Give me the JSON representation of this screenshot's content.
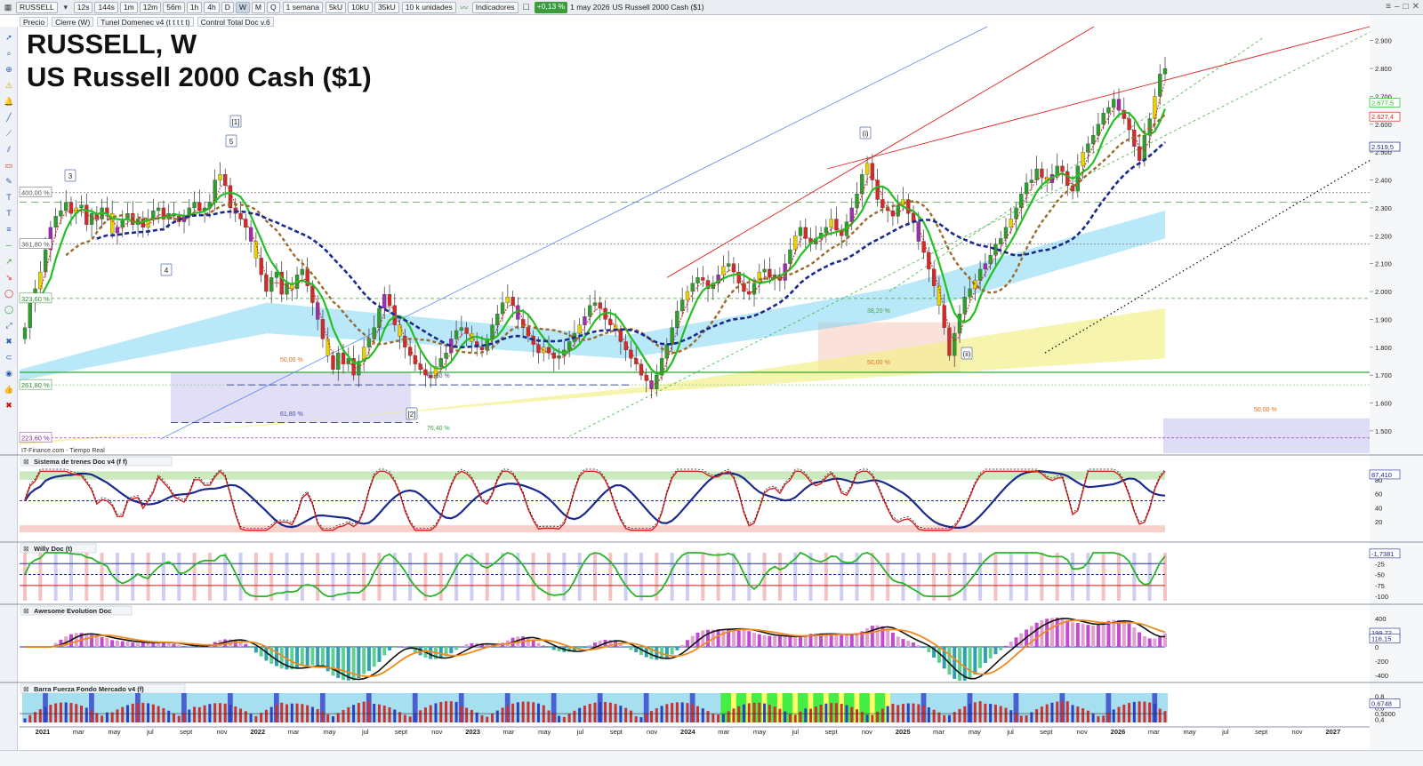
{
  "toolbar": {
    "symbol": "RUSSELL",
    "timeframes": [
      "12s",
      "144s",
      "1m",
      "12m",
      "56m",
      "1h",
      "4h",
      "D",
      "W",
      "M",
      "Q"
    ],
    "active_timeframe": "W",
    "period": "1 semana",
    "units_buttons": [
      "5kU",
      "10kU",
      "35kU"
    ],
    "units": "10 k unidades",
    "indicators": "Indicadores",
    "change_pct": "+0,13 %",
    "date": "1 may 2026",
    "instrument": "US Russell 2000 Cash ($1)"
  },
  "subbar": {
    "items": [
      "Precio",
      "Cierre (W)",
      "Tunel Domenec v4 (t t t t t)",
      "Control Total Doc v.6"
    ]
  },
  "title": {
    "line1": "RUSSELL, W",
    "line2": "US Russell 2000 Cash ($1)"
  },
  "source_label": "IT-Finance.com - Tiempo Real",
  "colors": {
    "up": "#2e9e2e",
    "down": "#d42a2a",
    "yellow_bar": "#e6d300",
    "purple_bar": "#9c2fb0",
    "green_line": "#22c022",
    "red_line": "#d92020",
    "blue_dots": "#1b2a8c",
    "brown_dots": "#9b6a2c",
    "cyan_band": "#7fd6f2",
    "yellow_band": "#f3f08a"
  },
  "chart_data": [
    {
      "type": "candlestick",
      "pane": "price",
      "title": "RUSSELL, W",
      "subtitle": "US Russell 2000 Cash ($1)",
      "y_ticks": [
        "2.900",
        "2.800",
        "2.700",
        "2.600",
        "2.500",
        "2.400",
        "2.300",
        "2.200",
        "2.100",
        "2.000",
        "1.900",
        "1.800",
        "1.700",
        "1.600",
        "1.500"
      ],
      "ylim": [
        1420,
        2950
      ],
      "price_labels": [
        {
          "text": "2.677,5",
          "value": 2677.5,
          "color": "#22c022"
        },
        {
          "text": "2.627,4",
          "value": 2627.4,
          "color": "#d92020"
        },
        {
          "text": "2.519,5",
          "value": 2519.5,
          "color": "#1b2a8c"
        }
      ],
      "x_ticks": [
        "2021",
        "mar",
        "may",
        "jul",
        "sept",
        "nov",
        "2022",
        "mar",
        "may",
        "jul",
        "sept",
        "nov",
        "2023",
        "mar",
        "may",
        "jul",
        "sept",
        "nov",
        "2024",
        "mar",
        "may",
        "jul",
        "sept",
        "nov",
        "2025",
        "mar",
        "may",
        "jul",
        "sept",
        "nov",
        "2026",
        "mar",
        "may",
        "jul",
        "sept",
        "nov",
        "2027",
        "mar"
      ],
      "closes": [
        1870,
        1960,
        2010,
        2070,
        2150,
        2230,
        2270,
        2290,
        2320,
        2280,
        2300,
        2310,
        2240,
        2280,
        2260,
        2300,
        2280,
        2210,
        2230,
        2260,
        2280,
        2240,
        2260,
        2230,
        2260,
        2290,
        2300,
        2260,
        2280,
        2270,
        2250,
        2270,
        2300,
        2320,
        2290,
        2300,
        2320,
        2400,
        2420,
        2380,
        2300,
        2280,
        2260,
        2230,
        2180,
        2120,
        2060,
        2000,
        2050,
        2070,
        1990,
        2030,
        2010,
        2060,
        2080,
        2020,
        1960,
        1900,
        1830,
        1770,
        1720,
        1780,
        1740,
        1760,
        1700,
        1750,
        1800,
        1830,
        1870,
        1940,
        1990,
        1950,
        1880,
        1840,
        1800,
        1770,
        1740,
        1720,
        1700,
        1690,
        1730,
        1760,
        1780,
        1830,
        1860,
        1870,
        1850,
        1820,
        1800,
        1790,
        1830,
        1880,
        1920,
        1960,
        1980,
        1950,
        1900,
        1870,
        1840,
        1810,
        1780,
        1800,
        1780,
        1760,
        1770,
        1790,
        1820,
        1850,
        1880,
        1910,
        1950,
        1960,
        1940,
        1900,
        1880,
        1860,
        1820,
        1790,
        1760,
        1740,
        1700,
        1680,
        1650,
        1700,
        1760,
        1810,
        1870,
        1930,
        1970,
        2000,
        2030,
        2050,
        2040,
        2010,
        2030,
        2060,
        2090,
        2100,
        2070,
        2030,
        2000,
        1990,
        2030,
        2070,
        2080,
        2050,
        2060,
        2040,
        2100,
        2150,
        2200,
        2230,
        2190,
        2170,
        2190,
        2210,
        2230,
        2260,
        2220,
        2200,
        2250,
        2300,
        2350,
        2420,
        2460,
        2400,
        2330,
        2300,
        2290,
        2270,
        2310,
        2330,
        2280,
        2250,
        2180,
        2140,
        2080,
        2020,
        1950,
        1870,
        1770,
        1850,
        1920,
        1980,
        2010,
        2040,
        2080,
        2100,
        2130,
        2170,
        2190,
        2230,
        2260,
        2300,
        2350,
        2390,
        2400,
        2440,
        2410,
        2390,
        2420,
        2450,
        2430,
        2380,
        2360,
        2450,
        2500,
        2530,
        2560,
        2600,
        2640,
        2660,
        2690,
        2650,
        2620,
        2580,
        2520,
        2470,
        2560,
        2620,
        2700,
        2780,
        2800
      ]
    },
    {
      "type": "line",
      "pane": "oscillator",
      "title": "Sistema de trenes Doc v4 (f f)",
      "y_ticks": [
        "80",
        "60",
        "40",
        "20"
      ],
      "labels": [
        {
          "text": "87,410",
          "value": 87.41
        }
      ],
      "ylim": [
        0,
        100
      ]
    },
    {
      "type": "line",
      "pane": "oscillator",
      "title": "Willy Doc (t)",
      "y_ticks": [
        "-25",
        "-50",
        "-75",
        "-100"
      ],
      "labels": [
        {
          "text": "-1,7381",
          "value": -1.7381
        }
      ],
      "ylim": [
        -110,
        0
      ]
    },
    {
      "type": "bar",
      "pane": "oscillator",
      "title": "Awesome Evolution Doc",
      "y_ticks": [
        "400",
        "200",
        "0",
        "-200",
        "-400"
      ],
      "labels": [
        {
          "text": "199,72",
          "value": 199.72
        },
        {
          "text": "116,15",
          "value": 116.15
        }
      ],
      "ylim": [
        -450,
        450
      ]
    },
    {
      "type": "bar",
      "pane": "oscillator",
      "title": "Barra Fuerza Fondo Mercado v4 (f)",
      "y_ticks": [
        "0,8",
        "0,6",
        "0,5000",
        "0,4"
      ],
      "labels": [
        {
          "text": "0,6748",
          "value": 0.6748
        }
      ],
      "ylim": [
        0.35,
        0.85
      ]
    }
  ],
  "annotations": {
    "wave_labels": [
      "3",
      "[1]",
      "5",
      "4",
      "[2]",
      "(i)",
      "(ii)"
    ],
    "fib_levels": [
      "400,00 %",
      "361,80 %",
      "323,60 %",
      "261,80 %",
      "223,60 %"
    ],
    "fib_small": [
      "50,00 %",
      "61,80 %",
      "61,80 %",
      "76,40 %",
      "38,20 %",
      "50,00 %",
      "50,00 %"
    ]
  }
}
